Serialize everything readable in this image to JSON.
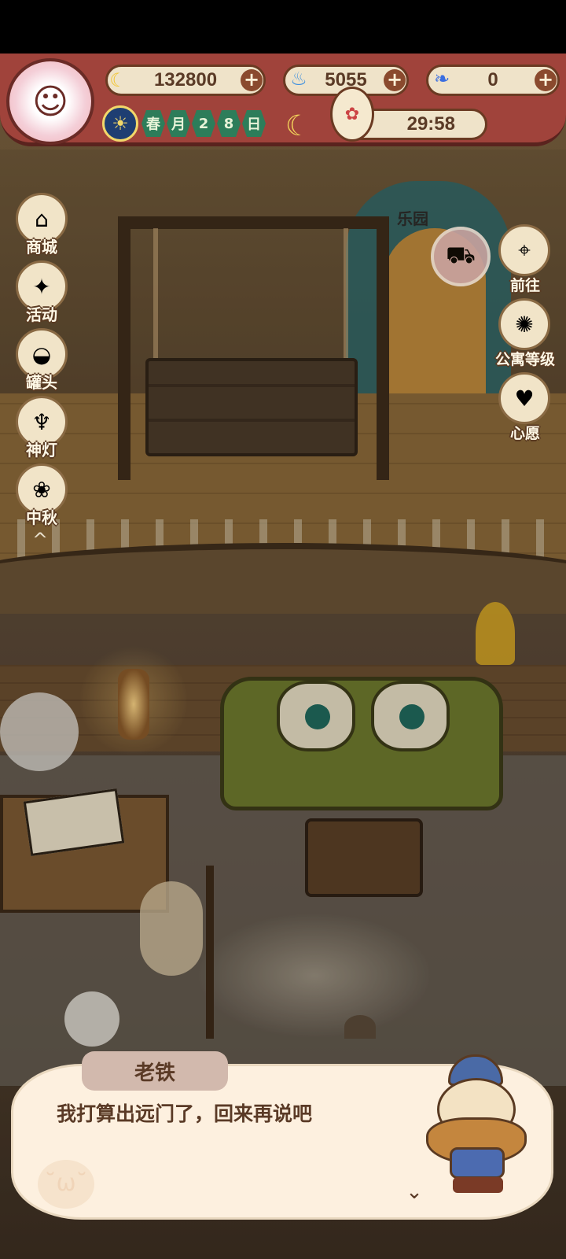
{
  "hud": {
    "avatar_icon": "player-avatar",
    "banana": {
      "icon": "banana-icon",
      "value": "132800",
      "plus": "+"
    },
    "flame": {
      "icon": "blue-flame-icon",
      "value": "5055",
      "plus": "+"
    },
    "feather": {
      "icon": "blue-feather-icon",
      "value": "0",
      "plus": "+"
    },
    "season": {
      "icon": "day-night-icon",
      "cells": [
        "春",
        "月",
        "2",
        "8",
        "日"
      ]
    },
    "moon_icon": "moon-icon",
    "timer": "29:58"
  },
  "left_menu": [
    {
      "label": "商城",
      "icon": "shop-icon"
    },
    {
      "label": "活动",
      "icon": "gift-icon"
    },
    {
      "label": "罐头",
      "icon": "can-icon"
    },
    {
      "label": "神灯",
      "icon": "magic-lamp-icon"
    },
    {
      "label": "中秋",
      "icon": "mid-autumn-icon"
    }
  ],
  "right_menu": [
    {
      "label": "前往",
      "icon": "map-pin-icon"
    },
    {
      "label": "公寓等级",
      "icon": "apartment-level-icon"
    },
    {
      "label": "心愿",
      "icon": "wish-heart-icon"
    }
  ],
  "scene": {
    "gate_sign": "乐园"
  },
  "dialog": {
    "speaker": "老铁",
    "text": "我打算出远门了，回来再说吧",
    "next": "⌄"
  },
  "colors": {
    "hud_band": "#a0433b",
    "pill_bg": "#efe3c9",
    "dialog_bg": "#fdf0df",
    "text_brown": "#5a3a26"
  }
}
